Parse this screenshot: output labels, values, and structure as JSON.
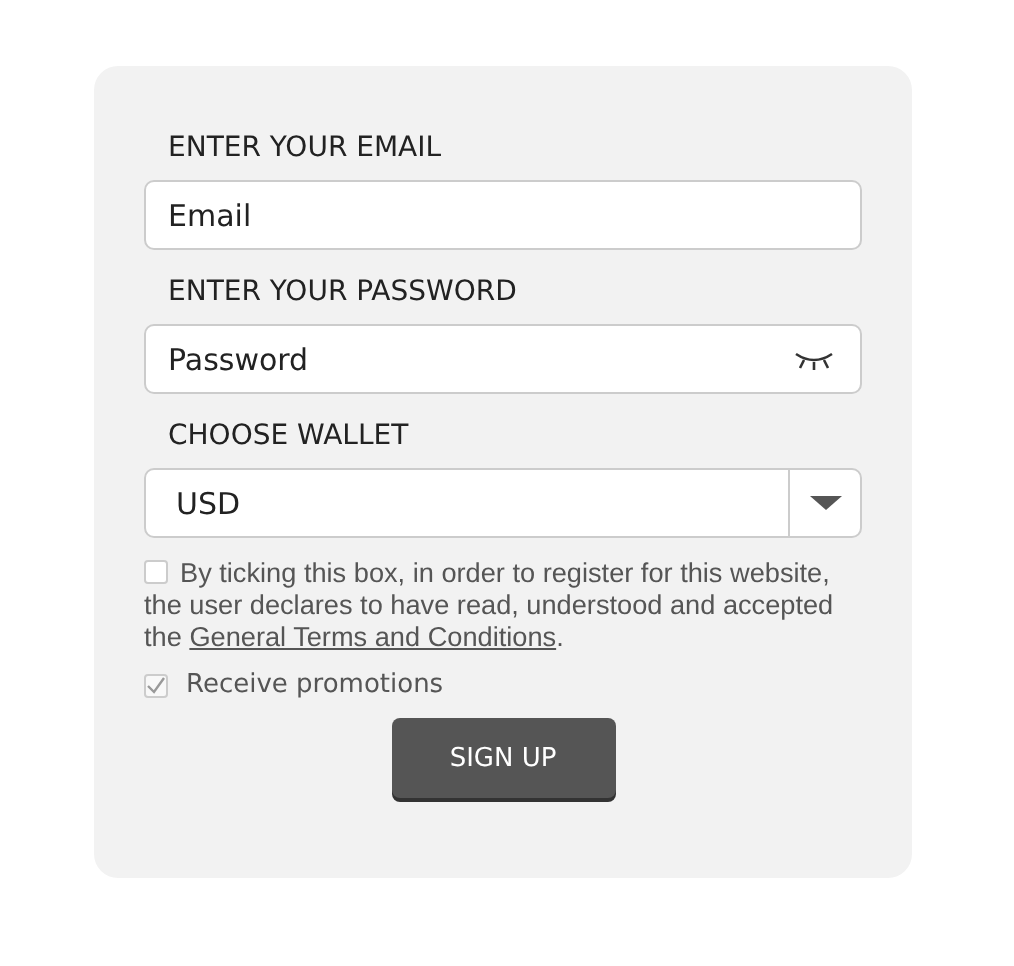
{
  "form": {
    "email": {
      "label": "ENTER YOUR EMAIL",
      "placeholder": "Email"
    },
    "password": {
      "label": "ENTER YOUR PASSWORD",
      "placeholder": "Password"
    },
    "wallet": {
      "label": "CHOOSE WALLET",
      "value": "USD"
    },
    "terms": {
      "checked": false,
      "text_before": "By ticking this box, in order to register for this website, the user declares to have read, understood and accepted the ",
      "link": "General Terms and Conditions",
      "text_after": "."
    },
    "promotions": {
      "checked": true,
      "label": "Receive promotions"
    },
    "submit": "SIGN UP"
  }
}
